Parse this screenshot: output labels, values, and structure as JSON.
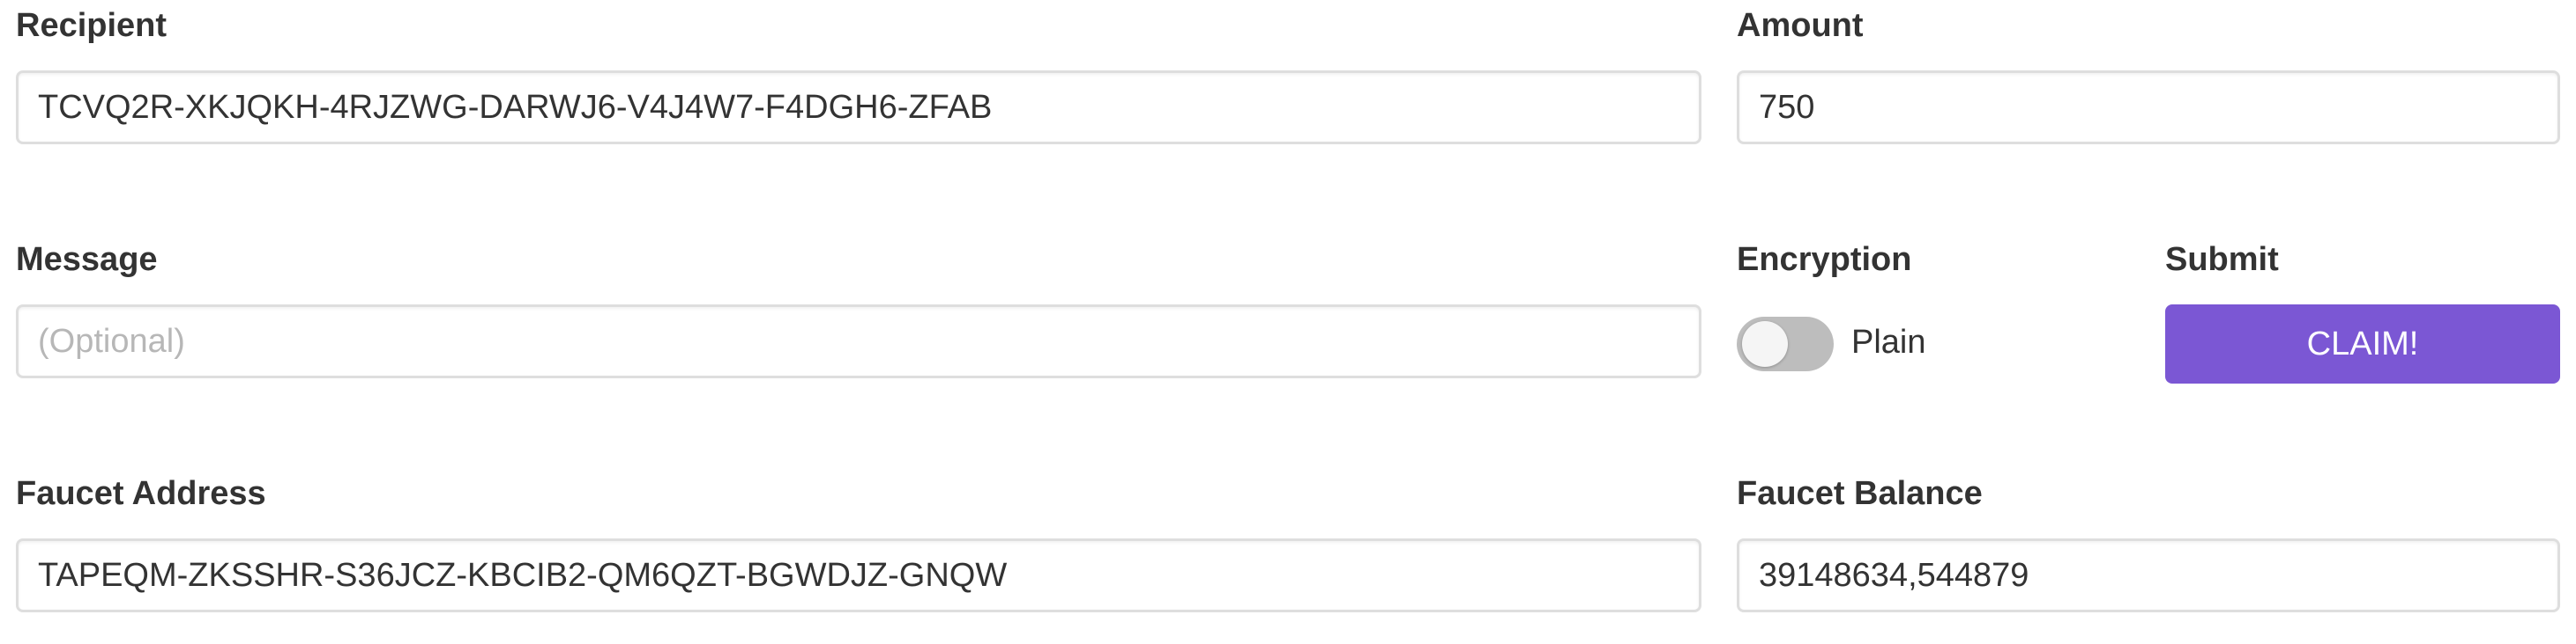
{
  "recipient": {
    "label": "Recipient",
    "value": "TCVQ2R-XKJQKH-4RJZWG-DARWJ6-V4J4W7-F4DGH6-ZFAB"
  },
  "amount": {
    "label": "Amount",
    "value": "750"
  },
  "message": {
    "label": "Message",
    "value": "",
    "placeholder": "(Optional)"
  },
  "encryption": {
    "label": "Encryption",
    "toggle_label": "Plain",
    "enabled": false
  },
  "submit": {
    "label": "Submit",
    "button_label": "CLAIM!"
  },
  "faucet_address": {
    "label": "Faucet Address",
    "value": "TAPEQM-ZKSSHR-S36JCZ-KBCIB2-QM6QZT-BGWDJZ-GNQW"
  },
  "faucet_balance": {
    "label": "Faucet Balance",
    "value": "39148634,544879"
  },
  "colors": {
    "accent": "#7b57d4",
    "toggle_off": "#bdbdbd",
    "border": "#dedede",
    "placeholder": "#b7b7b7"
  }
}
